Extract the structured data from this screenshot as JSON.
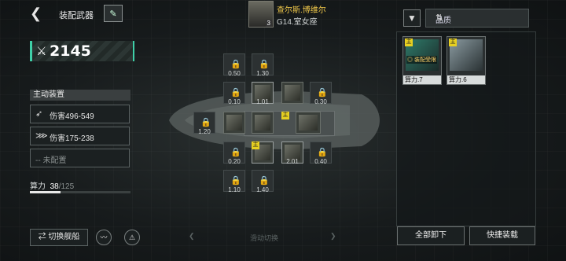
{
  "header": {
    "back_icon": "back-arrow-icon",
    "title": "装配武器",
    "pilot": {
      "name": "查尔斯.博维尔",
      "class": "G14.室女座",
      "level": "3"
    },
    "filter_icon": "filter-icon",
    "quality_label": "品质",
    "sort_icon": "sort-icon"
  },
  "power": {
    "value": "2145",
    "icon": "crossed-swords-icon"
  },
  "active_equipment": {
    "header": "主动装置",
    "items": [
      {
        "icon": "wing-icon",
        "label": "伤害496-549"
      },
      {
        "icon": "claw-icon",
        "label": "伤害175-238"
      },
      {
        "icon": "empty-icon",
        "label": "-- 未配置"
      }
    ]
  },
  "compute": {
    "label": "算力",
    "used": "38",
    "total": "/125",
    "fill": 0.304
  },
  "buttons": {
    "switch_ship": "⇄ 切换舰船",
    "unload_all": "全部卸下",
    "quick_equip": "快捷装载",
    "slide_hint": "滑动切换"
  },
  "slots": {
    "row1": [
      "0.50",
      "1.30"
    ],
    "row2": [
      "0.10",
      "1.01",
      "",
      "0.30"
    ],
    "row3_left": "1.20",
    "row3_main": "主",
    "row4": [
      "0.20",
      "主",
      "2.01",
      "0.40"
    ],
    "row5": [
      "1.10",
      "1.40"
    ]
  },
  "inventory": [
    {
      "tag": "主",
      "status": "◎ 装配受限",
      "label": "算力.7"
    },
    {
      "tag": "主",
      "status": "",
      "label": "算力.6"
    }
  ],
  "colors": {
    "accent": "#3fd0a8",
    "main_tag": "#e8d020",
    "pilot_name": "#f0c84a"
  }
}
